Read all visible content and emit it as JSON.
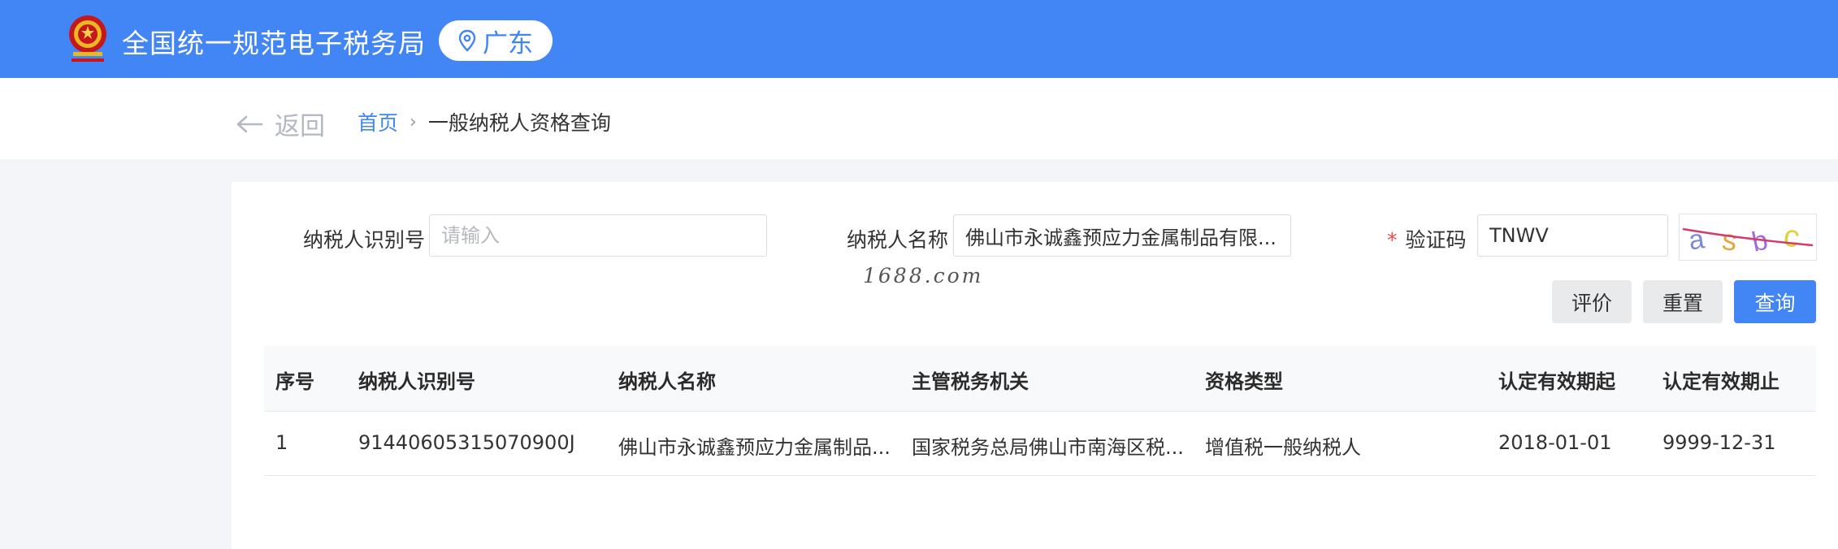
{
  "header": {
    "site_title": "全国统一规范电子税务局",
    "region": "广东",
    "brand_color": "#4285f4"
  },
  "nav": {
    "back_label": "返回",
    "breadcrumb_home": "首页",
    "breadcrumb_separator": "›",
    "breadcrumb_current": "一般纳税人资格查询"
  },
  "form": {
    "taxpayer_id_label": "纳税人识别号",
    "taxpayer_id_placeholder": "请输入",
    "taxpayer_id_value": "",
    "taxpayer_name_label": "纳税人名称",
    "taxpayer_name_value": "佛山市永诚鑫预应力金属制品有限...",
    "captcha_required_mark": "*",
    "captcha_label": "验证码",
    "captcha_value": "TNWV",
    "captcha_image_text": "asbc"
  },
  "watermark": "1688.com",
  "buttons": {
    "evaluate": "评价",
    "reset": "重置",
    "query": "查询"
  },
  "table": {
    "columns": [
      "序号",
      "纳税人识别号",
      "纳税人名称",
      "主管税务机关",
      "资格类型",
      "认定有效期起",
      "认定有效期止"
    ],
    "rows": [
      [
        "1",
        "91440605315070900J",
        "佛山市永诚鑫预应力金属制品...",
        "国家税务总局佛山市南海区税...",
        "增值税一般纳税人",
        "2018-01-01",
        "9999-12-31"
      ]
    ]
  }
}
